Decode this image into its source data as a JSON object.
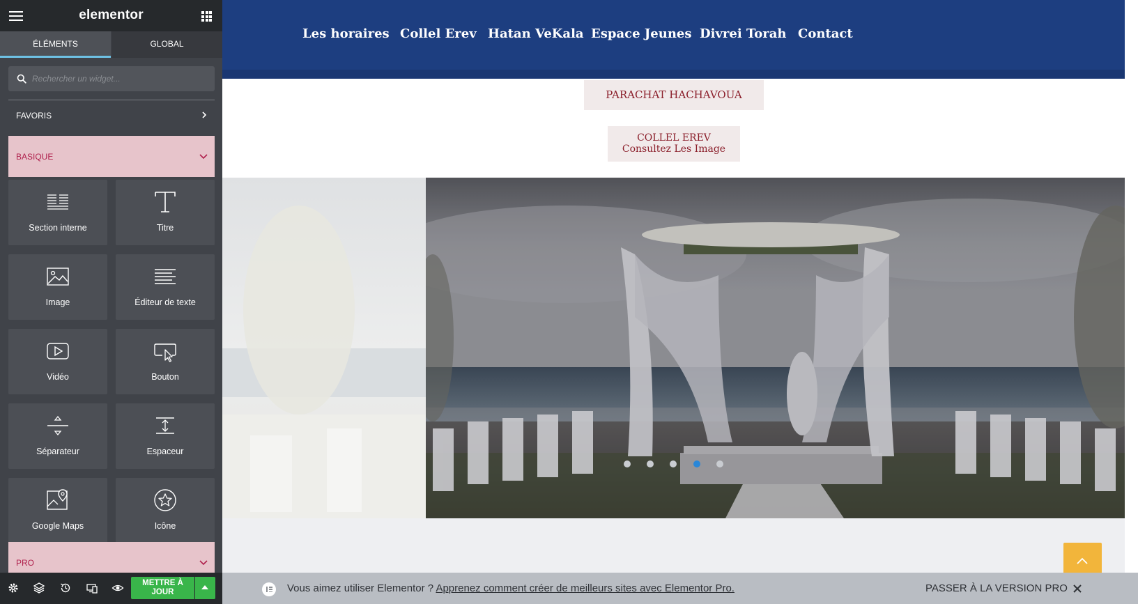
{
  "panel": {
    "logo": "elementor",
    "tabs": [
      {
        "label": "ÉLÉMENTS",
        "active": true
      },
      {
        "label": "GLOBAL",
        "active": false
      }
    ],
    "search": {
      "placeholder": "Rechercher un widget..."
    },
    "favorites_label": "FAVORIS",
    "categories": [
      {
        "label": "BASIQUE",
        "expanded": true
      },
      {
        "label": "PRO",
        "expanded": true
      }
    ],
    "widgets": [
      {
        "label": "Section interne",
        "icon": "inner-section-icon"
      },
      {
        "label": "Titre",
        "icon": "heading-icon"
      },
      {
        "label": "Image",
        "icon": "image-icon"
      },
      {
        "label": "Éditeur de texte",
        "icon": "text-editor-icon"
      },
      {
        "label": "Vidéo",
        "icon": "video-icon"
      },
      {
        "label": "Bouton",
        "icon": "button-icon"
      },
      {
        "label": "Séparateur",
        "icon": "divider-icon"
      },
      {
        "label": "Espaceur",
        "icon": "spacer-icon"
      },
      {
        "label": "Google Maps",
        "icon": "google-maps-icon"
      },
      {
        "label": "Icône",
        "icon": "star-icon"
      }
    ],
    "footer": {
      "update_button_line1": "METTRE À",
      "update_button_line2": "JOUR",
      "icons": [
        "settings-icon",
        "navigator-icon",
        "history-icon",
        "responsive-icon",
        "preview-icon"
      ]
    },
    "colors": {
      "accent": "#6ec1e4",
      "category": "#e7c4cb",
      "update": "#39b54a"
    }
  },
  "site": {
    "nav": [
      "Les horaires",
      "Collel Erev",
      "Hatan VeKala",
      "Espace Jeunes",
      "Divrei Torah",
      "Contact"
    ],
    "buttons": {
      "parachat": "PARACHAT HACHAVOUA",
      "collel_line1": "COLLEL EREV",
      "collel_line2": "Consultez Les Image"
    },
    "slider": {
      "slide_count": 5,
      "active_index": 3
    },
    "colors": {
      "nav_bg": "#1d3e80",
      "button_text": "#8b1f2b",
      "scroll_top": "#f2b53b"
    }
  },
  "promo": {
    "text": "Vous aimez utiliser Elementor ?",
    "link": "Apprenez comment créer de meilleurs sites avec Elementor Pro.",
    "go_pro": "PASSER À LA VERSION PRO"
  }
}
